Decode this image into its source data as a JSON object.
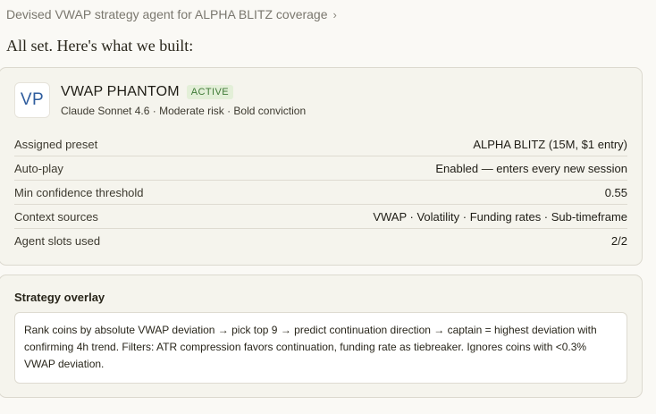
{
  "breadcrumb": {
    "label": "Devised VWAP strategy agent for ALPHA BLITZ coverage",
    "chevron": "›"
  },
  "intro": "All set. Here's what we built:",
  "agent": {
    "avatar": "VP",
    "name": "VWAP PHANTOM",
    "status": "ACTIVE",
    "subtitle": "Claude Sonnet 4.6 · Moderate risk · Bold conviction"
  },
  "details": [
    {
      "label": "Assigned preset",
      "value": "ALPHA BLITZ (15M, $1 entry)"
    },
    {
      "label": "Auto-play",
      "value": "Enabled — enters every new session"
    },
    {
      "label": "Min confidence threshold",
      "value": "0.55"
    },
    {
      "label": "Context sources",
      "value": "VWAP · Volatility · Funding rates · Sub-timeframe"
    },
    {
      "label": "Agent slots used",
      "value": "2/2"
    }
  ],
  "overlay": {
    "title": "Strategy overlay",
    "text": "Rank coins by absolute VWAP deviation → pick top 9 → predict continuation direction → captain = highest deviation with confirming 4h trend. Filters: ATR compression favors continuation, funding rate as tiebreaker. Ignores coins with <0.3% VWAP deviation."
  },
  "colors": {
    "accent": "#2f5d9e",
    "active_badge_bg": "#e3efd8",
    "active_badge_fg": "#3f7a36",
    "page_bg": "#faf9f5"
  }
}
